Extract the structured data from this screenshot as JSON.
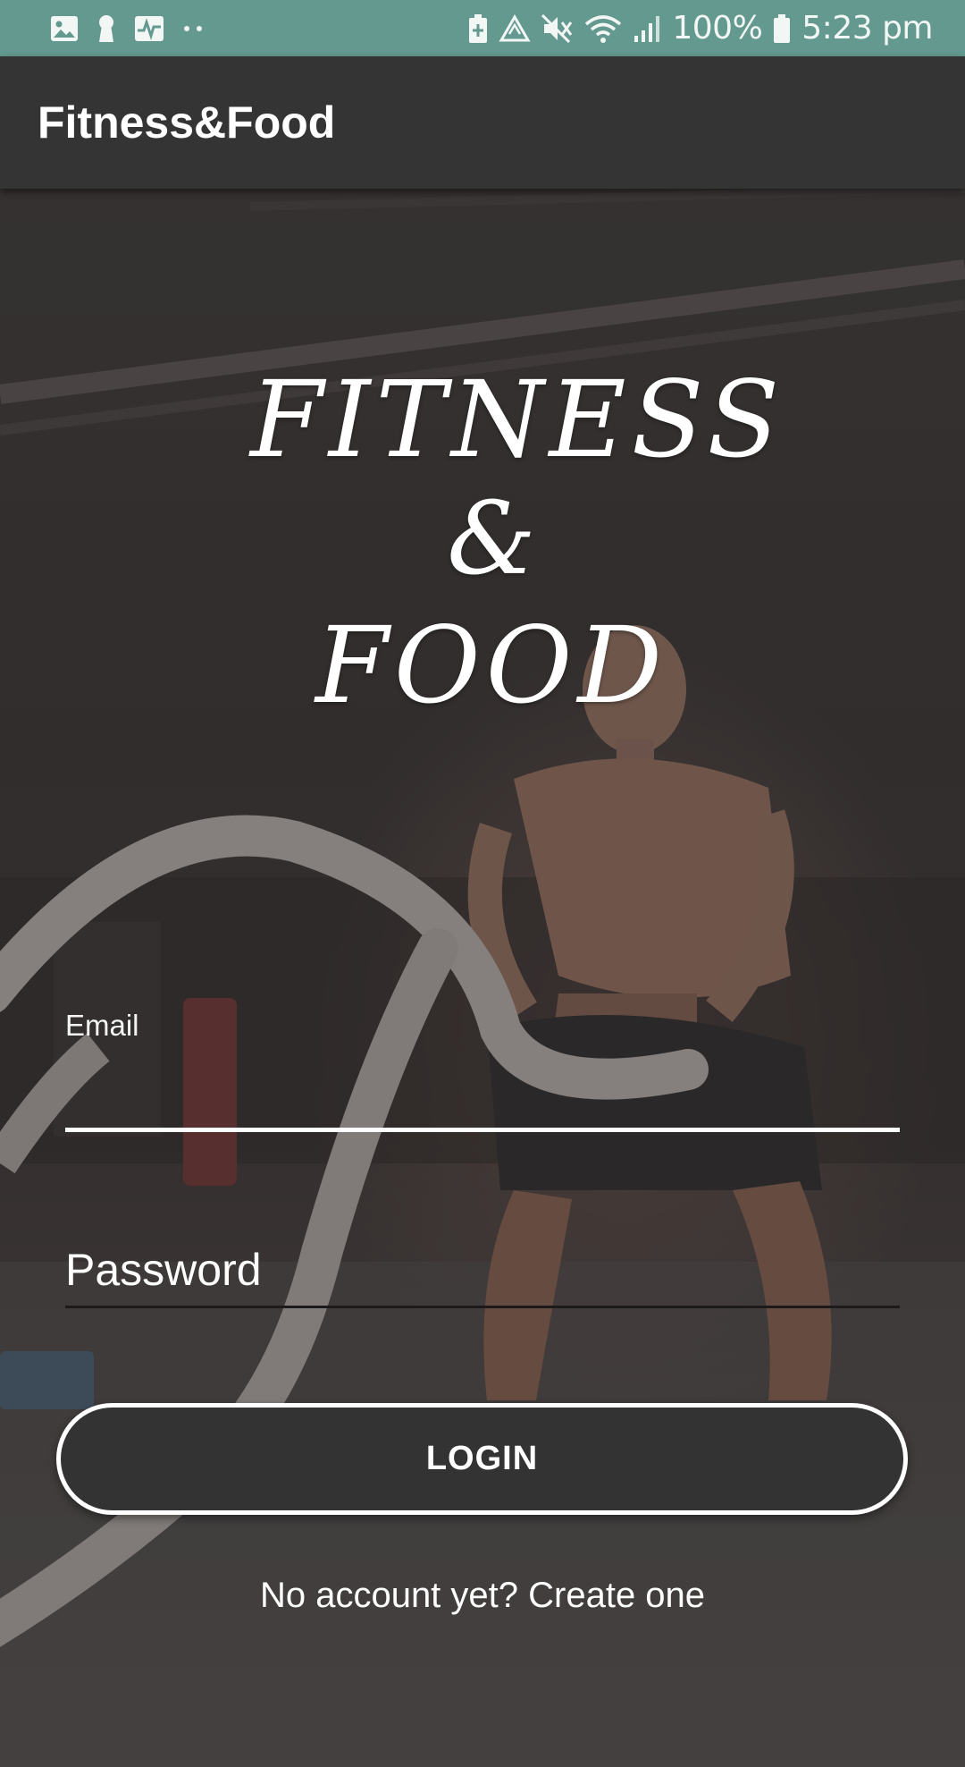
{
  "status_bar": {
    "battery_percent": "100%",
    "time": "5:23 pm",
    "icons": [
      "image-icon",
      "keyhole-icon",
      "activity-icon",
      "more-dots-icon",
      "battery-saver-icon",
      "recycle-icon",
      "mute-icon",
      "wifi-icon",
      "signal-icon",
      "battery-icon"
    ]
  },
  "app_bar": {
    "title": "Fitness&Food"
  },
  "logo": {
    "line1": "FITNESS",
    "line2": "&",
    "line3": "FOOD"
  },
  "form": {
    "email_label": "Email",
    "email_value": "",
    "password_placeholder": "Password",
    "login_label": "LOGIN",
    "signup_link": "No account yet? Create one"
  },
  "colors": {
    "status_bar": "#63998f",
    "app_bar": "#353434",
    "button_fill": "#343333",
    "text": "#ffffff"
  }
}
